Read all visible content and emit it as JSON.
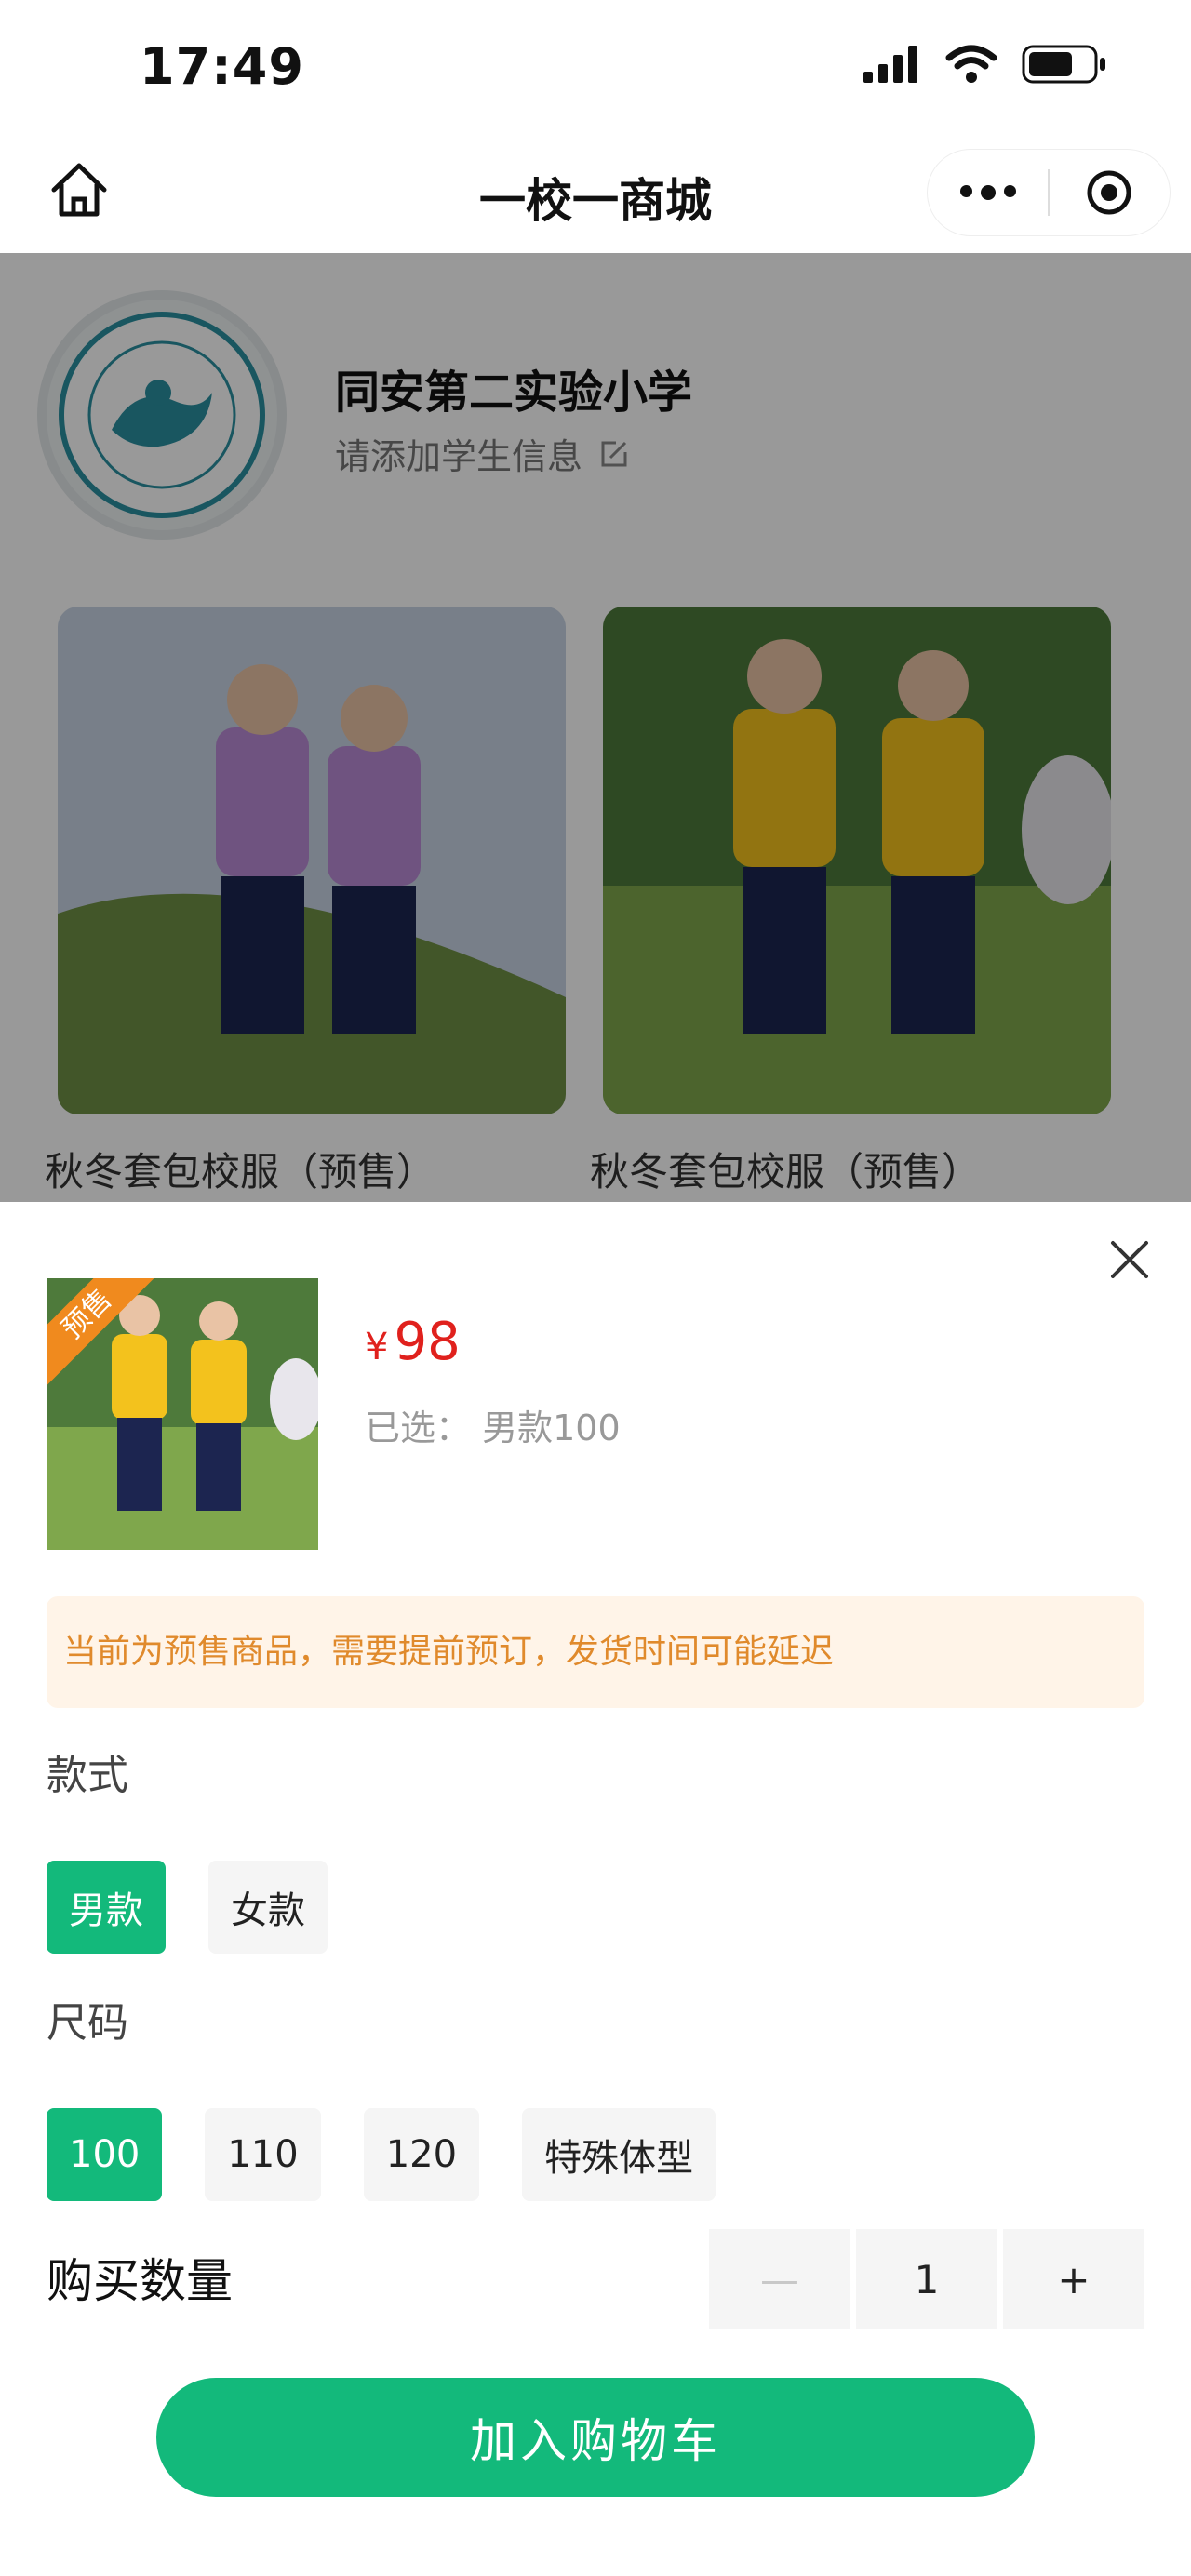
{
  "status_bar": {
    "time": "17:49"
  },
  "nav": {
    "title": "一校一商城"
  },
  "school": {
    "name": "同安第二实验小学",
    "subtitle": "请添加学生信息"
  },
  "products": [
    {
      "name": "秋冬套包校服（预售）"
    },
    {
      "name": "秋冬套包校服（预售）"
    }
  ],
  "sheet": {
    "ribbon": "预售",
    "currency": "¥",
    "price": "98",
    "selected_prefix": "已选：",
    "selected_value": "男款100",
    "notice": "当前为预售商品，需要提前预订，发货时间可能延迟",
    "style_label": "款式",
    "style_options": [
      "男款",
      "女款"
    ],
    "size_label": "尺码",
    "size_options": [
      "100",
      "110",
      "120",
      "特殊体型"
    ],
    "quantity_label": "购买数量",
    "quantity": "1",
    "minus": "—",
    "plus": "+",
    "add_to_cart": "加入购物车"
  },
  "colors": {
    "accent": "#13b97b",
    "price": "#e0211d",
    "notice_text": "#e08a2c",
    "notice_bg": "#fff4e8",
    "ribbon": "#f08a1e"
  }
}
